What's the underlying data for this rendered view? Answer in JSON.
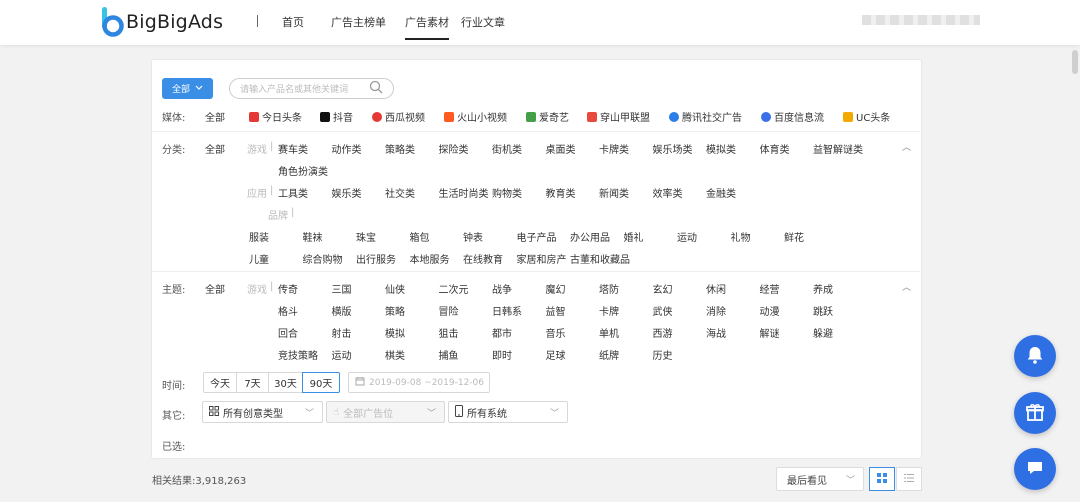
{
  "header": {
    "logo_text": "BigBigAds",
    "nav": [
      {
        "label": "首页"
      },
      {
        "label": "广告主榜单"
      },
      {
        "label": "广告素材"
      },
      {
        "label": "行业文章"
      }
    ]
  },
  "filter": {
    "all_button": "全部",
    "search_placeholder": "请输入产品名或其他关键词",
    "media": {
      "label": "媒体:",
      "all": "全部",
      "items": [
        "今日头条",
        "抖音",
        "西瓜视频",
        "火山小视频",
        "爱奇艺",
        "穿山甲联盟",
        "腾讯社交广告",
        "百度信息流",
        "UC头条"
      ],
      "icon_colors": [
        "#e53935",
        "#111111",
        "#e53935",
        "#ff5a1f",
        "#43a047",
        "#e84a3c",
        "#2b7de9",
        "#3a6fe8",
        "#f2a900"
      ]
    },
    "category": {
      "label": "分类:",
      "all": "全部",
      "game_label": "游戏",
      "game": [
        "赛车类",
        "动作类",
        "策略类",
        "探险类",
        "街机类",
        "桌面类",
        "卡牌类",
        "娱乐场类",
        "模拟类",
        "体育类",
        "益智解谜类",
        "角色扮演类"
      ],
      "app_label": "应用",
      "app": [
        "工具类",
        "娱乐类",
        "社交类",
        "生活时尚类",
        "购物类",
        "教育类",
        "新闻类",
        "效率类",
        "金融类"
      ],
      "brand_label": "品牌",
      "brand": [
        "服装",
        "鞋袜",
        "珠宝",
        "箱包",
        "钟表",
        "电子产品",
        "办公用品",
        "婚礼",
        "运动",
        "礼物",
        "鲜花",
        "儿童",
        "综合购物",
        "出行服务",
        "本地服务",
        "在线教育",
        "家居和房产",
        "古董和收藏品"
      ]
    },
    "theme": {
      "label": "主题:",
      "all": "全部",
      "game_label": "游戏",
      "items": [
        "传奇",
        "三国",
        "仙侠",
        "二次元",
        "战争",
        "魔幻",
        "塔防",
        "玄幻",
        "休闲",
        "经营",
        "养成",
        "格斗",
        "横版",
        "策略",
        "冒险",
        "日韩系",
        "益智",
        "卡牌",
        "武侠",
        "消除",
        "动漫",
        "跳跃",
        "回合",
        "射击",
        "模拟",
        "狙击",
        "都市",
        "音乐",
        "单机",
        "西游",
        "海战",
        "解谜",
        "躲避",
        "竞技策略",
        "运动",
        "棋类",
        "捕鱼",
        "即时",
        "足球",
        "纸牌",
        "历史"
      ]
    },
    "time": {
      "label": "时间:",
      "options": [
        "今天",
        "7天",
        "30天",
        "90天"
      ],
      "selected": "90天",
      "date_range": "2019-09-08 ~2019-12-06"
    },
    "other": {
      "label": "其它:",
      "creative_type": "所有创意类型",
      "ad_position": "全部广告位",
      "system": "所有系统"
    },
    "selected_label": "已选:"
  },
  "results": {
    "count_text": "相关结果:3,918,263",
    "sort": "最后看见"
  }
}
